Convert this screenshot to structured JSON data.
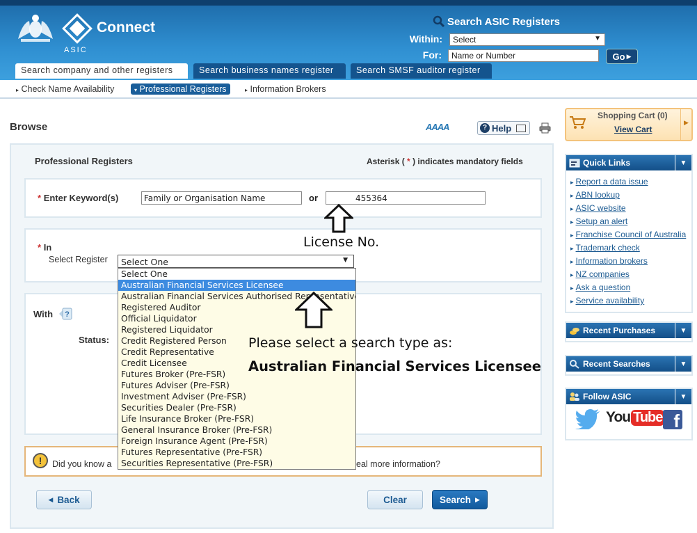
{
  "header": {
    "asic_text": "ASIC",
    "connect_text": "Connect",
    "search_title": "Search ASIC Registers",
    "within_label": "Within:",
    "within_value": "Select",
    "for_label": "For:",
    "for_value": "Name or Number",
    "go_label": "Go",
    "tabs": [
      {
        "label": "Search company and other registers",
        "active": true
      },
      {
        "label": "Search business names register",
        "active": false
      },
      {
        "label": "Search SMSF auditor register",
        "active": false
      }
    ]
  },
  "subnav": [
    {
      "label": "Check Name Availability",
      "active": false
    },
    {
      "label": "Professional Registers",
      "active": true
    },
    {
      "label": "Information Brokers",
      "active": false
    }
  ],
  "main": {
    "heading": "Browse",
    "font_size_label": "AAAA",
    "help_label": "Help",
    "panel_title": "Professional Registers",
    "mandatory_note_pre": "Asterisk (",
    "mandatory_star": "*",
    "mandatory_note_post": ") indicates mandatory fields",
    "keyword_label": "Enter Keyword(s)",
    "keyword_value": "Family or Organisation Name",
    "or_text": "or",
    "license_value": "455364",
    "in_label": "In",
    "select_register_label": "Select Register",
    "select_register_value": "Select One",
    "register_options": [
      "Select One",
      "Australian Financial Services Licensee",
      "Australian Financial Services Authorised Representative",
      "Registered Auditor",
      "Official Liquidator",
      "Registered Liquidator",
      "Credit Registered Person",
      "Credit Representative",
      "Credit Licensee",
      "Futures Broker (Pre-FSR)",
      "Futures Adviser (Pre-FSR)",
      "Investment Adviser (Pre-FSR)",
      "Securities Dealer (Pre-FSR)",
      "Life Insurance Broker (Pre-FSR)",
      "General Insurance Broker (Pre-FSR)",
      "Foreign Insurance Agent (Pre-FSR)",
      "Futures Representative (Pre-FSR)",
      "Securities Representative (Pre-FSR)"
    ],
    "highlighted_option": "Australian Financial Services Licensee",
    "with_label": "With",
    "status_label": "Status:",
    "tip_icon": "!",
    "tip_text_start": "Did you know a",
    "tip_text_end": "eal more information?",
    "back_label": "Back",
    "clear_label": "Clear",
    "search_label": "Search"
  },
  "annotations": {
    "license_note": "License No.",
    "instruction_line1": "Please select a search type as:",
    "instruction_line2": "Australian Financial Services Licensee"
  },
  "sidebar": {
    "cart_title": "Shopping Cart (0)",
    "cart_link": "View Cart",
    "quick_links_title": "Quick Links",
    "quick_links": [
      "Report a data issue",
      "ABN lookup",
      "ASIC website",
      "Setup an alert",
      "Franchise Council of Australia",
      "Trademark check",
      "Information brokers",
      "NZ companies",
      "Ask a question",
      "Service availability"
    ],
    "recent_purchases_title": "Recent Purchases",
    "recent_searches_title": "Recent Searches",
    "follow_title": "Follow ASIC",
    "youtube_you": "You",
    "youtube_tube": "Tube"
  },
  "colors": {
    "header_blue": "#2f8fd1",
    "tab_dark": "#14548e",
    "highlight": "#3d8be0",
    "button_dark": "#125a9d",
    "tip_border": "#e5b67a",
    "cart_bg": "#fde2b3",
    "twitter": "#55acee",
    "youtube_red": "#e52d27",
    "facebook": "#3b5998"
  }
}
